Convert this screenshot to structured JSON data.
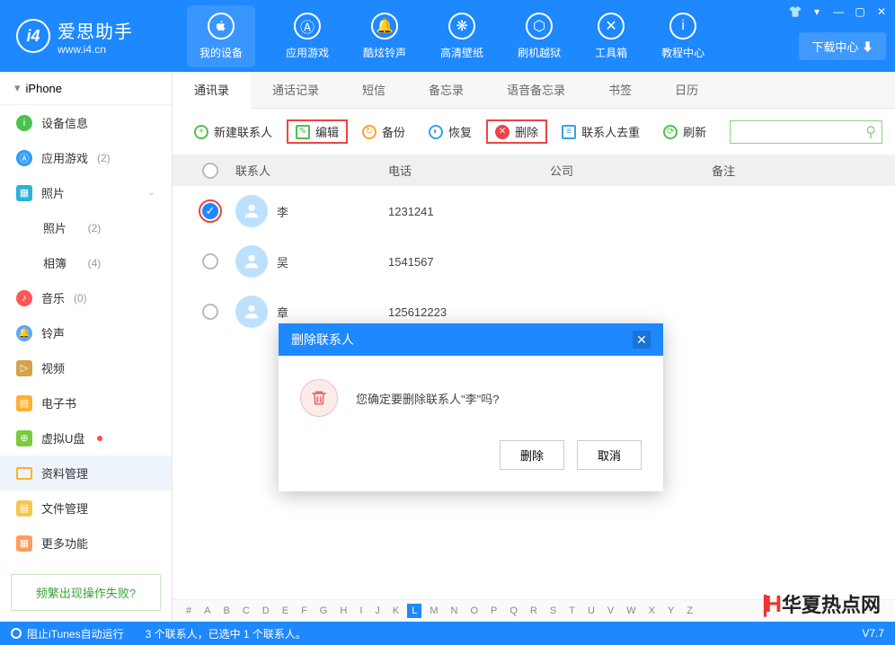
{
  "header": {
    "logo_title": "爱思助手",
    "logo_url": "www.i4.cn",
    "nav": [
      "我的设备",
      "应用游戏",
      "酷炫铃声",
      "高清壁纸",
      "刷机越狱",
      "工具箱",
      "教程中心"
    ],
    "download_center": "下载中心"
  },
  "sidebar": {
    "device": "iPhone",
    "items": [
      {
        "label": "设备信息"
      },
      {
        "label": "应用游戏",
        "count": "(2)"
      },
      {
        "label": "照片",
        "expandable": true
      },
      {
        "label": "照片",
        "count": "(2)",
        "sub": true
      },
      {
        "label": "相簿",
        "count": "(4)",
        "sub": true
      },
      {
        "label": "音乐",
        "count": "(0)"
      },
      {
        "label": "铃声"
      },
      {
        "label": "视频"
      },
      {
        "label": "电子书"
      },
      {
        "label": "虚拟U盘",
        "dot": true
      },
      {
        "label": "资料管理",
        "selected": true
      },
      {
        "label": "文件管理"
      },
      {
        "label": "更多功能"
      }
    ],
    "help_link": "频繁出现操作失败?"
  },
  "tabs": [
    "通讯录",
    "通话记录",
    "短信",
    "备忘录",
    "语音备忘录",
    "书签",
    "日历"
  ],
  "toolbar": {
    "new": "新建联系人",
    "edit": "编辑",
    "backup": "备份",
    "restore": "恢复",
    "delete": "删除",
    "dedupe": "联系人去重",
    "refresh": "刷新"
  },
  "table": {
    "headers": {
      "name": "联系人",
      "phone": "电话",
      "company": "公司",
      "note": "备注"
    },
    "rows": [
      {
        "name": "李",
        "phone": "1231241",
        "checked": true
      },
      {
        "name": "吴",
        "phone": "1541567",
        "checked": false
      },
      {
        "name": "章",
        "phone": "125612223",
        "checked": false
      }
    ]
  },
  "alphabet": [
    "#",
    "A",
    "B",
    "C",
    "D",
    "E",
    "F",
    "G",
    "H",
    "I",
    "J",
    "K",
    "L",
    "M",
    "N",
    "O",
    "P",
    "Q",
    "R",
    "S",
    "T",
    "U",
    "V",
    "W",
    "X",
    "Y",
    "Z"
  ],
  "alphabet_selected": "L",
  "dialog": {
    "title": "删除联系人",
    "message": "您确定要删除联系人\"李\"吗?",
    "confirm": "删除",
    "cancel": "取消"
  },
  "footer": {
    "itunes": "阻止iTunes自动运行",
    "status": "3 个联系人，已选中 1 个联系人。",
    "version": "V7.7"
  },
  "watermark": "华夏热点网"
}
